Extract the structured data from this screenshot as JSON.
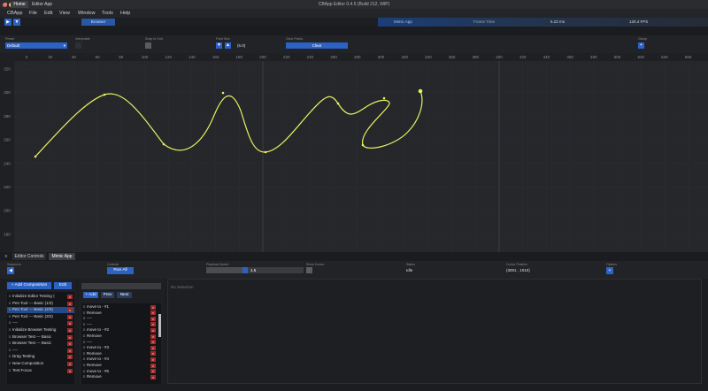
{
  "window": {
    "title": "CBApp Editor 0.4.5 (Build 212, WIP)"
  },
  "menu": [
    "CBApp",
    "File",
    "Edit",
    "View",
    "Window",
    "Tools",
    "Help"
  ],
  "toolbar": {
    "browser_label": "Browser",
    "play_icon": "play-icon",
    "pause_icon": "pause-icon"
  },
  "stats": {
    "mimic_label": "Mimic App",
    "time_label": "Frame Time",
    "time_value": "5.22 ms",
    "fps_value": "120.4 FPS"
  },
  "tabs": {
    "home": "Home",
    "editor_app": "Editor App"
  },
  "controls": {
    "preset_value": "Default",
    "labels": [
      "Preset",
      "Interpolate",
      "Snap to Grid",
      "Point Size",
      "Clear Points",
      "Clamp"
    ],
    "point_size_value": "(5.0)",
    "clear_label": "Clear",
    "clamp_label": "+"
  },
  "canvas": {
    "x_ticks": [
      "0",
      "20",
      "40",
      "60",
      "80",
      "100",
      "120",
      "140",
      "160",
      "180",
      "200",
      "220",
      "240",
      "260",
      "280",
      "300",
      "320",
      "340",
      "360",
      "380",
      "400",
      "420",
      "440",
      "460",
      "480",
      "500",
      "520",
      "540",
      "560",
      "580",
      "600"
    ],
    "y_ticks": [
      "320",
      "300",
      "280",
      "260",
      "240",
      "220",
      "200",
      "180"
    ],
    "curve_color": "#e8f060"
  },
  "bottom_tabs": {
    "editor_controls": "Editor Controls",
    "mimic_app": "Mimic App"
  },
  "mimic": {
    "labels": [
      "Sequence",
      "Controls",
      "Playback Speed",
      "Show Cursor",
      "Status",
      "Cursor Position",
      "Options"
    ],
    "run_label": "Run All",
    "speed_value": "1.5",
    "speed_fraction": 0.4,
    "status_value": "Idle",
    "cursor_value": "(3001 , 1010)",
    "options_label": "+"
  },
  "compositions": {
    "add_label": "+ Add Composition",
    "edit_label": "Edit",
    "items": [
      "Initialize Editor Testing ⟨",
      "Pen Tool --- Basic (1/3)",
      "Pen Tool --- Basic (2/3)",
      "Pen Tool --- Basic (3/3)",
      "----",
      "Initialize Browser Testing",
      "Browser Test --- Basic",
      "Browser Test --- Basic",
      "----",
      "Drag Testing",
      "New Composition",
      "Test Focus"
    ],
    "selected_index": 2
  },
  "steps": {
    "add_label": "+ Add",
    "prev_label": "Prev",
    "next_label": "Next",
    "items": [
      "move to - #1",
      "Remove",
      "----",
      "----",
      "move to - #2",
      "Remove",
      "----",
      "move to - #3",
      "Remove",
      "move to - #4",
      "Remove",
      "move to - #5",
      "Remove"
    ]
  },
  "detail": {
    "empty_label": "No Selection"
  }
}
